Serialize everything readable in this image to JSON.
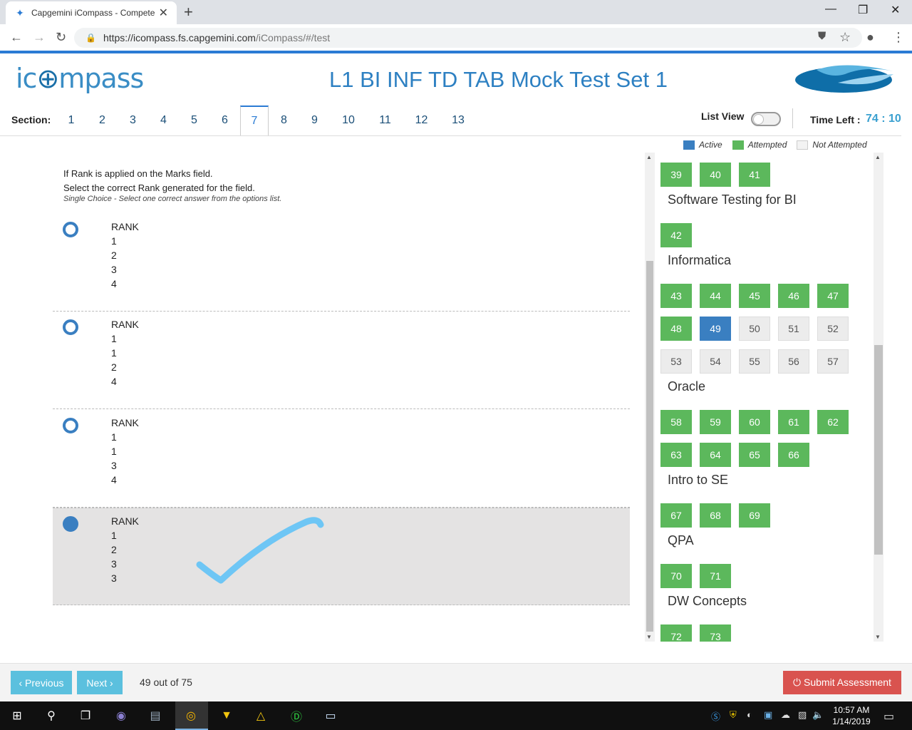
{
  "browser": {
    "tab_title": "Capgemini iCompass - Competen",
    "url_host": "https://icompass.fs.capgemini.com",
    "url_path": "/iCompass/#/test"
  },
  "app": {
    "logo_text_pre": "ic",
    "logo_text_o": "⊕",
    "logo_text_post": "mpass",
    "title": "L1 BI INF TD TAB Mock Test Set 1"
  },
  "sections": {
    "label": "Section:",
    "tabs": [
      "1",
      "2",
      "3",
      "4",
      "5",
      "6",
      "7",
      "8",
      "9",
      "10",
      "11",
      "12",
      "13"
    ],
    "active_index": 6
  },
  "list_view_label": "List View",
  "timer": {
    "label": "Time Left :",
    "value": "74 : 10"
  },
  "question": {
    "line1": "If Rank is applied on the Marks field.",
    "line2": "Select the correct Rank generated for the field.",
    "hint": "Single Choice - Select one correct answer from the options list.",
    "options": [
      {
        "lines": [
          "RANK",
          "1",
          "2",
          "3",
          "4"
        ],
        "selected": false
      },
      {
        "lines": [
          "RANK",
          "1",
          "1",
          "2",
          "4"
        ],
        "selected": false
      },
      {
        "lines": [
          "RANK",
          "1",
          "1",
          "3",
          "4"
        ],
        "selected": false
      },
      {
        "lines": [
          "RANK",
          "1",
          "2",
          "3",
          "3"
        ],
        "selected": true
      }
    ]
  },
  "legend": {
    "active": "Active",
    "attempted": "Attempted",
    "not_attempted": "Not Attempted"
  },
  "colors": {
    "active": "#3a7fc1",
    "attempted": "#5cb85c",
    "not_attempted": "#ececec",
    "accent": "#2a7bd4",
    "submit": "#d9534f",
    "nav": "#5bc0de"
  },
  "palette_groups": [
    {
      "title": "",
      "rows": [
        [
          {
            "n": "39",
            "s": "att"
          },
          {
            "n": "40",
            "s": "att"
          },
          {
            "n": "41",
            "s": "att"
          }
        ]
      ]
    },
    {
      "title": "Software Testing for BI",
      "rows": [
        [
          {
            "n": "42",
            "s": "att"
          }
        ]
      ]
    },
    {
      "title": "Informatica",
      "rows": [
        [
          {
            "n": "43",
            "s": "att"
          },
          {
            "n": "44",
            "s": "att"
          },
          {
            "n": "45",
            "s": "att"
          },
          {
            "n": "46",
            "s": "att"
          },
          {
            "n": "47",
            "s": "att"
          }
        ],
        [
          {
            "n": "48",
            "s": "att"
          },
          {
            "n": "49",
            "s": "act"
          },
          {
            "n": "50",
            "s": "not"
          },
          {
            "n": "51",
            "s": "not"
          },
          {
            "n": "52",
            "s": "not"
          }
        ],
        [
          {
            "n": "53",
            "s": "not"
          },
          {
            "n": "54",
            "s": "not"
          },
          {
            "n": "55",
            "s": "not"
          },
          {
            "n": "56",
            "s": "not"
          },
          {
            "n": "57",
            "s": "not"
          }
        ]
      ]
    },
    {
      "title": "Oracle",
      "rows": [
        [
          {
            "n": "58",
            "s": "att"
          },
          {
            "n": "59",
            "s": "att"
          },
          {
            "n": "60",
            "s": "att"
          },
          {
            "n": "61",
            "s": "att"
          },
          {
            "n": "62",
            "s": "att"
          }
        ],
        [
          {
            "n": "63",
            "s": "att"
          },
          {
            "n": "64",
            "s": "att"
          },
          {
            "n": "65",
            "s": "att"
          },
          {
            "n": "66",
            "s": "att"
          }
        ]
      ]
    },
    {
      "title": "Intro to SE",
      "rows": [
        [
          {
            "n": "67",
            "s": "att"
          },
          {
            "n": "68",
            "s": "att"
          },
          {
            "n": "69",
            "s": "att"
          }
        ]
      ]
    },
    {
      "title": "QPA",
      "rows": [
        [
          {
            "n": "70",
            "s": "att"
          },
          {
            "n": "71",
            "s": "att"
          }
        ]
      ]
    },
    {
      "title": "DW Concepts",
      "rows": [
        [
          {
            "n": "72",
            "s": "att"
          },
          {
            "n": "73",
            "s": "att"
          }
        ]
      ]
    }
  ],
  "footer": {
    "prev_label": "‹ Previous",
    "next_label": "Next ›",
    "counter": "49 out of 75",
    "submit_label": "⏻ Submit Assessment"
  },
  "taskbar": {
    "time": "10:57 AM",
    "date": "1/14/2019"
  }
}
